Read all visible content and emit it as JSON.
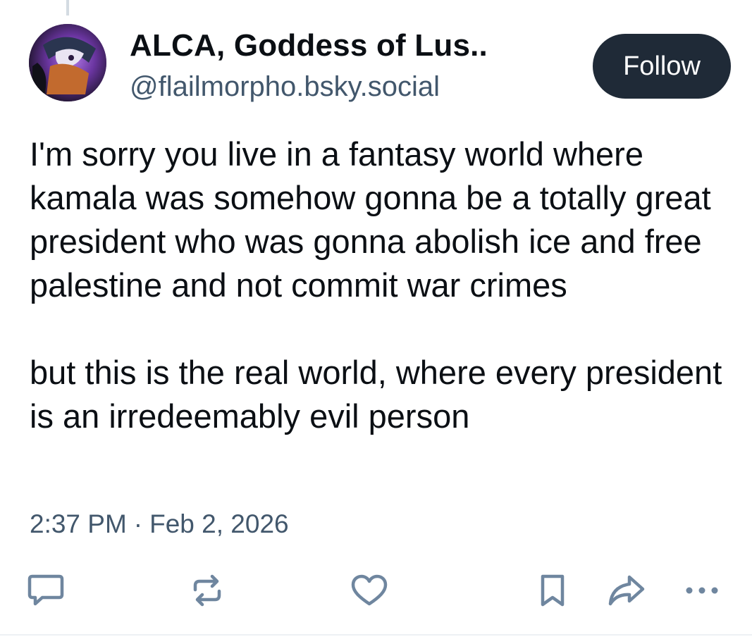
{
  "author": {
    "display_name": "ALCA, Goddess of Lus..",
    "handle": "@flailmorpho.bsky.social"
  },
  "follow_button": {
    "label": "Follow"
  },
  "post": {
    "paragraph_1": "I'm sorry you live in a fantasy world where kamala was somehow gonna be a totally great president who was gonna abolish ice and free palestine and not commit war crimes",
    "paragraph_2": "but this is the real world, where every president is an irredeemably evil person",
    "time": "2:37 PM",
    "separator": "·",
    "date": "Feb 2, 2026"
  },
  "actions": [
    {
      "icon": "reply-icon"
    },
    {
      "icon": "repost-icon"
    },
    {
      "icon": "like-heart-icon"
    },
    {
      "icon": "bookmark-icon"
    },
    {
      "icon": "share-icon"
    },
    {
      "icon": "more-options-icon"
    }
  ],
  "colors": {
    "text_primary": "#0b0f14",
    "text_secondary": "#42576c",
    "icon": "#6f869f",
    "follow_button_bg": "#1f2a37",
    "follow_button_text": "#ffffff"
  }
}
